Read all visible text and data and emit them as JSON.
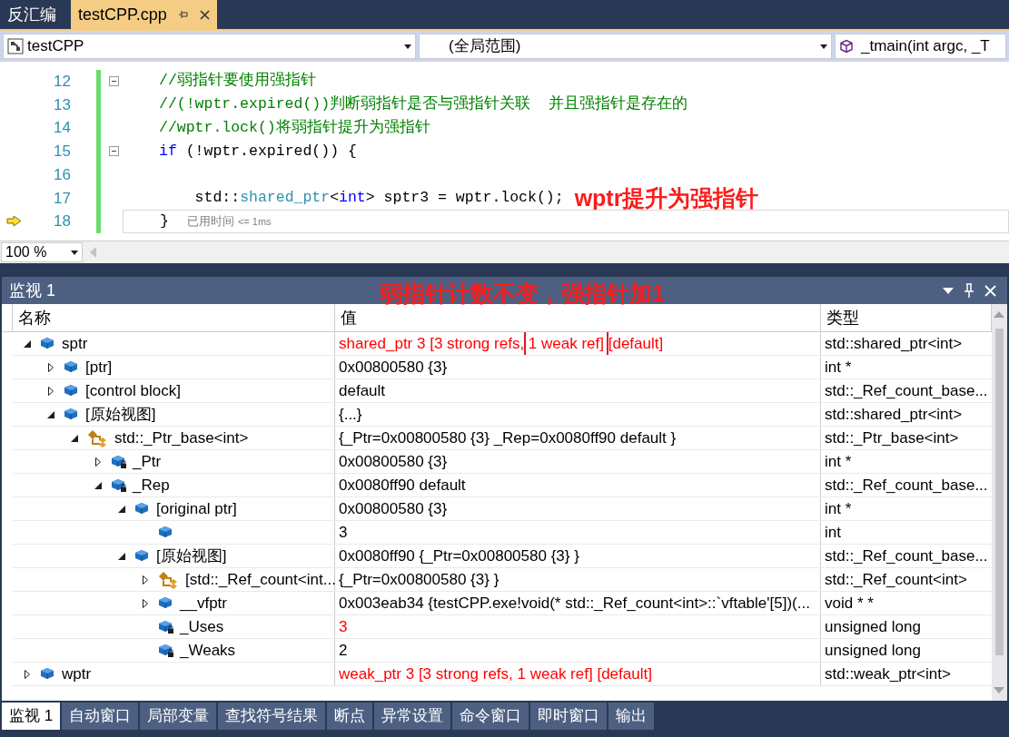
{
  "doc_tabs": [
    {
      "label": "反汇编",
      "selected": false
    },
    {
      "label": "testCPP.cpp",
      "selected": true
    }
  ],
  "nav": {
    "project": "testCPP",
    "scope": "(全局范围)",
    "member": "_tmain(int argc, _T"
  },
  "code_lines": [
    {
      "number": "12",
      "fold": true,
      "current": false,
      "tokens": [
        {
          "kind": "comment",
          "text": "//弱指针要使用强指针"
        }
      ]
    },
    {
      "number": "13",
      "fold": false,
      "current": false,
      "tokens": [
        {
          "kind": "comment",
          "text": "//(!wptr.expired())判断弱指针是否与强指针关联  并且强指针是存在的"
        }
      ]
    },
    {
      "number": "14",
      "fold": false,
      "current": false,
      "tokens": [
        {
          "kind": "comment",
          "text": "//wptr.lock()将弱指针提升为强指针"
        }
      ]
    },
    {
      "number": "15",
      "fold": true,
      "current": false,
      "tokens": [
        {
          "kind": "keyword",
          "text": "if"
        },
        {
          "kind": "plain",
          "text": " (!wptr.expired()) {"
        }
      ]
    },
    {
      "number": "16",
      "fold": false,
      "current": false
    },
    {
      "number": "17",
      "fold": false,
      "current": false,
      "tokens": [
        {
          "kind": "plain",
          "text": "    std::"
        },
        {
          "kind": "type",
          "text": "shared_ptr"
        },
        {
          "kind": "plain",
          "text": "<"
        },
        {
          "kind": "keyword",
          "text": "int"
        },
        {
          "kind": "plain",
          "text": "> sptr3 = wptr.lock();"
        }
      ],
      "note": "wptr提升为强指针"
    },
    {
      "number": "18",
      "fold": false,
      "current": true,
      "tokens": [
        {
          "kind": "plain",
          "text": "}"
        },
        {
          "kind": "tip",
          "text": "已用时间"
        },
        {
          "kind": "tipsmall",
          "text": "<= 1ms"
        }
      ]
    }
  ],
  "zoom": "100 %",
  "watch": {
    "title": "监视 1",
    "note": "弱指针计数不变，强指针加1",
    "columns": [
      "名称",
      "值",
      "类型"
    ],
    "rows": [
      {
        "name": "sptr",
        "kind": "field",
        "locked": false,
        "expanded": true,
        "changed": true,
        "value": [
          {
            "text": "shared_ptr 3 [3 strong refs, ",
            "boxed": false
          },
          {
            "text": "1 weak ref]",
            "boxed": true
          },
          {
            "text": " [default]",
            "boxed": false
          }
        ],
        "type": "std::shared_ptr<int>",
        "children": [
          {
            "name": "[ptr]",
            "kind": "field",
            "locked": false,
            "expanded": false,
            "changed": false,
            "value": [
              {
                "text": "0x00800580 {3}",
                "boxed": false
              }
            ],
            "type": "int *"
          },
          {
            "name": "[control block]",
            "kind": "field",
            "locked": false,
            "expanded": false,
            "changed": false,
            "value": [
              {
                "text": "default",
                "boxed": false
              }
            ],
            "type": "std::_Ref_count_base..."
          },
          {
            "name": "[原始视图]",
            "kind": "field",
            "locked": false,
            "expanded": true,
            "changed": false,
            "value": [
              {
                "text": "{...}",
                "boxed": false
              }
            ],
            "type": "std::shared_ptr<int>",
            "children": [
              {
                "name": "std::_Ptr_base<int>",
                "kind": "base",
                "locked": false,
                "expanded": true,
                "changed": false,
                "value": [
                  {
                    "text": "{_Ptr=0x00800580 {3} _Rep=0x0080ff90 default }",
                    "boxed": false
                  }
                ],
                "type": "std::_Ptr_base<int>",
                "children": [
                  {
                    "name": "_Ptr",
                    "kind": "field",
                    "locked": true,
                    "expanded": false,
                    "changed": false,
                    "value": [
                      {
                        "text": "0x00800580 {3}",
                        "boxed": false
                      }
                    ],
                    "type": "int *"
                  },
                  {
                    "name": "_Rep",
                    "kind": "field",
                    "locked": true,
                    "expanded": true,
                    "changed": false,
                    "value": [
                      {
                        "text": "0x0080ff90 default",
                        "boxed": false
                      }
                    ],
                    "type": "std::_Ref_count_base...",
                    "children": [
                      {
                        "name": "[original ptr]",
                        "kind": "field",
                        "locked": false,
                        "expanded": true,
                        "changed": false,
                        "value": [
                          {
                            "text": "0x00800580 {3}",
                            "boxed": false
                          }
                        ],
                        "type": "int *",
                        "children": [
                          {
                            "kind": "field",
                            "locked": false,
                            "changed": false,
                            "value": [
                              {
                                "text": "3",
                                "boxed": false
                              }
                            ],
                            "type": "int"
                          }
                        ]
                      },
                      {
                        "name": "[原始视图]",
                        "kind": "field",
                        "locked": false,
                        "expanded": true,
                        "changed": false,
                        "value": [
                          {
                            "text": "0x0080ff90 {_Ptr=0x00800580 {3} }",
                            "boxed": false
                          }
                        ],
                        "type": "std::_Ref_count_base...",
                        "children": [
                          {
                            "name": "[std::_Ref_count<int...",
                            "kind": "base",
                            "locked": false,
                            "expanded": false,
                            "changed": false,
                            "value": [
                              {
                                "text": "{_Ptr=0x00800580 {3} }",
                                "boxed": false
                              }
                            ],
                            "type": "std::_Ref_count<int>"
                          },
                          {
                            "name": "__vfptr",
                            "kind": "field",
                            "locked": false,
                            "expanded": false,
                            "changed": false,
                            "value": [
                              {
                                "text": "0x003eab34 {testCPP.exe!void(* std::_Ref_count<int>::`vftable'[5])(...",
                                "boxed": false
                              }
                            ],
                            "type": "void * *"
                          },
                          {
                            "name": "_Uses",
                            "kind": "field",
                            "locked": true,
                            "changed": true,
                            "value": [
                              {
                                "text": "3",
                                "boxed": false
                              }
                            ],
                            "type": "unsigned long"
                          },
                          {
                            "name": "_Weaks",
                            "kind": "field",
                            "locked": true,
                            "changed": false,
                            "value": [
                              {
                                "text": "2",
                                "boxed": false
                              }
                            ],
                            "type": "unsigned long"
                          }
                        ]
                      }
                    ]
                  }
                ]
              }
            ]
          }
        ]
      },
      {
        "name": "wptr",
        "kind": "field",
        "locked": false,
        "expanded": false,
        "changed": true,
        "value": [
          {
            "text": "weak_ptr 3 [3 strong refs, 1 weak ref] [default]",
            "boxed": false
          }
        ],
        "type": "std::weak_ptr<int>"
      }
    ]
  },
  "tool_tabs": [
    {
      "label": "监视 1",
      "selected": true
    },
    {
      "label": "自动窗口",
      "selected": false
    },
    {
      "label": "局部变量",
      "selected": false
    },
    {
      "label": "查找符号结果",
      "selected": false
    },
    {
      "label": "断点",
      "selected": false
    },
    {
      "label": "异常设置",
      "selected": false
    },
    {
      "label": "命令窗口",
      "selected": false
    },
    {
      "label": "即时窗口",
      "selected": false
    },
    {
      "label": "输出",
      "selected": false
    }
  ]
}
